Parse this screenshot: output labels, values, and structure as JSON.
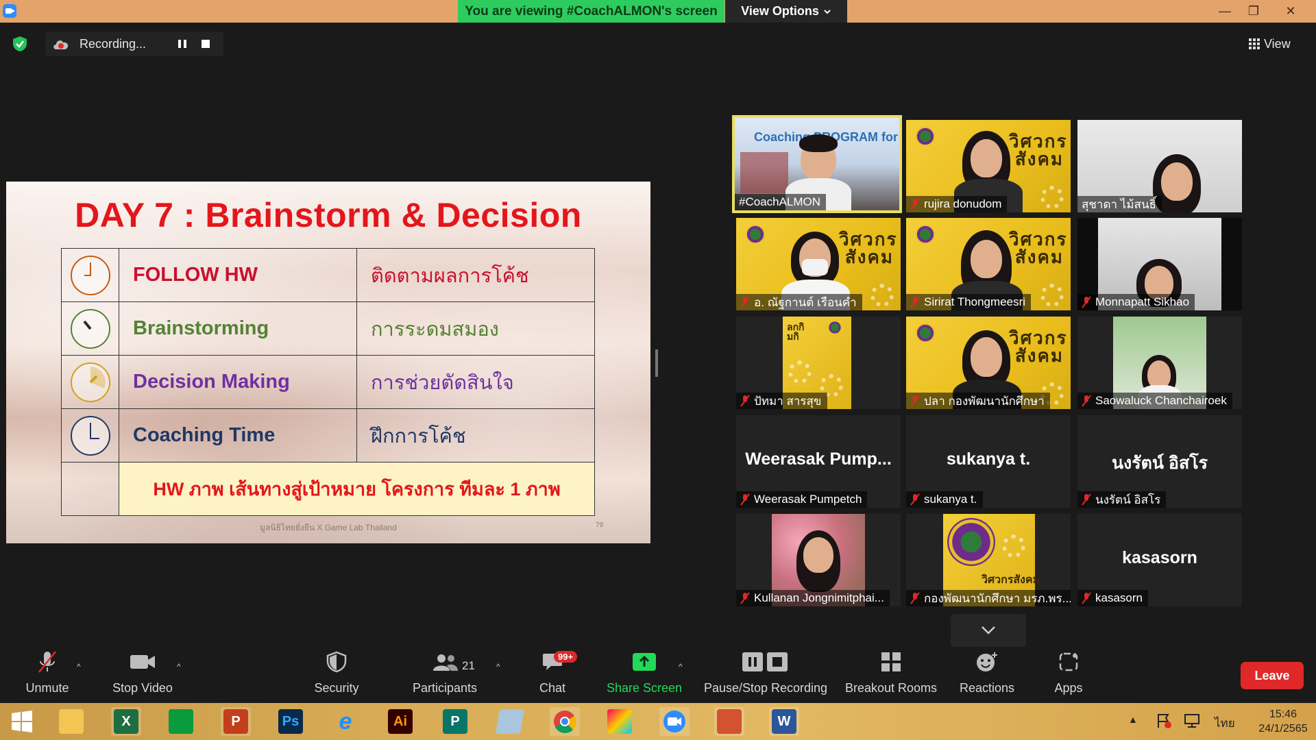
{
  "titlebar": {
    "viewing_text": "You are viewing #CoachALMON's screen",
    "view_options_label": "View Options",
    "banner_color": "#2ecc5e",
    "chevron_icon": "chevron-down-icon",
    "minimize_glyph": "—",
    "maximize_glyph": "❐",
    "close_glyph": "✕"
  },
  "overlay": {
    "recording_label": "Recording...",
    "view_label": "View"
  },
  "slide": {
    "title": "DAY 7 : Brainstorm & Decision",
    "rows": [
      {
        "en": "FOLLOW HW",
        "th": "ติดตามผลการโค้ช",
        "en_color": "#c8102e",
        "th_color": "#c8102e",
        "clock_color": "#c55a11"
      },
      {
        "en": "Brainstorming",
        "th": "การระดมสมอง",
        "en_color": "#548235",
        "th_color": "#548235",
        "clock_color": "#548235"
      },
      {
        "en": "Decision Making",
        "th": "การช่วยตัดสินใจ",
        "en_color": "#7030a0",
        "th_color": "#7030a0",
        "clock_color": "#d4a017"
      },
      {
        "en": "Coaching Time",
        "th": "ฝึกการโค้ช",
        "en_color": "#1f3864",
        "th_color": "#1f3864",
        "clock_color": "#1f3864"
      }
    ],
    "homework": "HW ภาพ เส้นทางสู่เป้าหมาย โครงการ ทีมละ 1 ภาพ",
    "footer": "มูลนิธิไทยยั่งยืน X Game Lab Thailand",
    "page_number": "79"
  },
  "gallery": {
    "coach_banner": "Coaching PROGRAM for  er",
    "badge_text": "วิศวกรสังคม",
    "badge_small_text": "ลกกิ\nมกิ",
    "tiles": [
      {
        "name": "#CoachALMON",
        "muted": false
      },
      {
        "name": "rujira donudom",
        "muted": true
      },
      {
        "name": "สุชาดา ไม้สนธิ์",
        "muted": false
      },
      {
        "name": "อ. ณัฐกานต์  เรือนคำ",
        "muted": true
      },
      {
        "name": "Sirirat Thongmeesri",
        "muted": true
      },
      {
        "name": "Monnapatt Sikhao",
        "muted": true
      },
      {
        "name": "ปัทมา สารสุข",
        "muted": true
      },
      {
        "name": "ปลา กองพัฒนานักศึกษา",
        "muted": true
      },
      {
        "name": "Saowaluck Chanchairoek",
        "muted": true
      },
      {
        "name": "Weerasak Pumpetch",
        "display": "Weerasak  Pump...",
        "muted": true
      },
      {
        "name": "sukanya t.",
        "display": "sukanya t.",
        "muted": true
      },
      {
        "name": "นงรัตน์ อิสโร",
        "display": "นงรัตน์ อิสโร",
        "muted": true
      },
      {
        "name": "Kullanan Jongnimitphai...",
        "muted": true
      },
      {
        "name": "กองพัฒนานักศึกษา มรภ.พร...",
        "muted": true
      },
      {
        "name": "kasasorn",
        "display": "kasasorn",
        "muted": true
      }
    ]
  },
  "toolbar": {
    "unmute": "Unmute",
    "stop_video": "Stop Video",
    "security": "Security",
    "participants": "Participants",
    "participants_count": "21",
    "chat": "Chat",
    "chat_badge": "99+",
    "share_screen": "Share Screen",
    "pause_stop_recording": "Pause/Stop Recording",
    "breakout_rooms": "Breakout Rooms",
    "reactions": "Reactions",
    "apps": "Apps",
    "leave": "Leave",
    "accent_green": "#23d959",
    "leave_color": "#e02828"
  },
  "taskbar": {
    "apps": [
      "windows-start",
      "file-explorer",
      "excel",
      "store",
      "powerpoint",
      "photoshop",
      "internet-explorer",
      "illustrator",
      "publisher",
      "notepad",
      "chrome",
      "paint",
      "zoom",
      "powerpoint-2",
      "word"
    ],
    "excel_letter": "X",
    "powerpoint_letter": "P",
    "photoshop_letters": "Ps",
    "ie_letter": "e",
    "illustrator_letters": "Ai",
    "publisher_letter": "P",
    "word_letter": "W",
    "language": "ไทย",
    "time": "15:46",
    "date": "24/1/2565"
  }
}
